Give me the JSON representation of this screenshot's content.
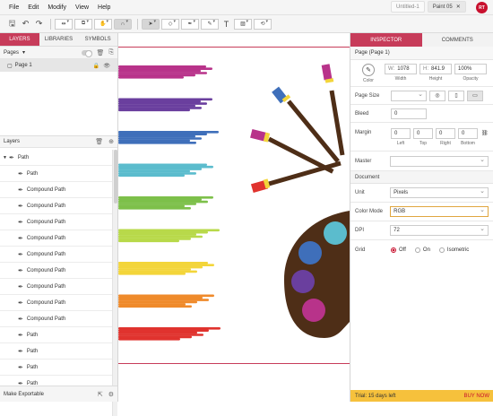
{
  "menu": [
    "File",
    "Edit",
    "Modify",
    "View",
    "Help"
  ],
  "doc_tabs": [
    {
      "label": "Untitled-1",
      "active": false
    },
    {
      "label": "Paint 05",
      "active": true
    }
  ],
  "user_initials": "RT",
  "left_panel": {
    "tabs": [
      "LAYERS",
      "LIBRARIES",
      "SYMBOLS"
    ],
    "pages_label": "Pages",
    "pages": [
      "Page 1"
    ],
    "layers_label": "Layers",
    "layers": [
      {
        "name": "Path",
        "top": true
      },
      {
        "name": "Path"
      },
      {
        "name": "Compound Path"
      },
      {
        "name": "Compound Path"
      },
      {
        "name": "Compound Path"
      },
      {
        "name": "Compound Path"
      },
      {
        "name": "Compound Path"
      },
      {
        "name": "Compound Path"
      },
      {
        "name": "Compound Path"
      },
      {
        "name": "Compound Path"
      },
      {
        "name": "Compound Path"
      },
      {
        "name": "Path"
      },
      {
        "name": "Path"
      },
      {
        "name": "Path"
      },
      {
        "name": "Path"
      }
    ],
    "footer_label": "Make Exportable"
  },
  "right_panel": {
    "tabs": [
      "INSPECTOR",
      "COMMENTS"
    ],
    "title": "Page (Page 1)",
    "color_label": "Color",
    "width": {
      "prefix": "W:",
      "value": "1078",
      "label": "Width"
    },
    "height": {
      "prefix": "H:",
      "value": "841.9",
      "label": "Height"
    },
    "opacity": {
      "value": "100%",
      "label": "Opacity"
    },
    "page_size_label": "Page Size",
    "bleed_label": "Bleed",
    "bleed_value": "0",
    "margin_label": "Margin",
    "margins": [
      {
        "value": "0",
        "label": "Left"
      },
      {
        "value": "0",
        "label": "Top"
      },
      {
        "value": "0",
        "label": "Right"
      },
      {
        "value": "0",
        "label": "Bottom"
      }
    ],
    "master_label": "Master",
    "document_label": "Document",
    "unit_label": "Unit",
    "unit_value": "Pixels",
    "color_mode_label": "Color Mode",
    "color_mode_value": "RGB",
    "dpi_label": "DPI",
    "dpi_value": "72",
    "grid_label": "Grid",
    "grid_options": [
      "Off",
      "On",
      "Isometric"
    ],
    "trial_text": "Trial: 15 days left",
    "buy_text": "BUY NOW"
  },
  "colors": {
    "accent": "#c73c5a",
    "stroke_colors": [
      "#b8338a",
      "#6a3f9e",
      "#3f6fba",
      "#5bbccd",
      "#7dc04a",
      "#b8d94a",
      "#f3d53a",
      "#ef8a2b",
      "#e0332e"
    ],
    "palette_wood": "#4e2e17",
    "paint_dots": [
      "#5bbccd",
      "#3f6fba",
      "#6a3f9e",
      "#b8338a"
    ]
  }
}
